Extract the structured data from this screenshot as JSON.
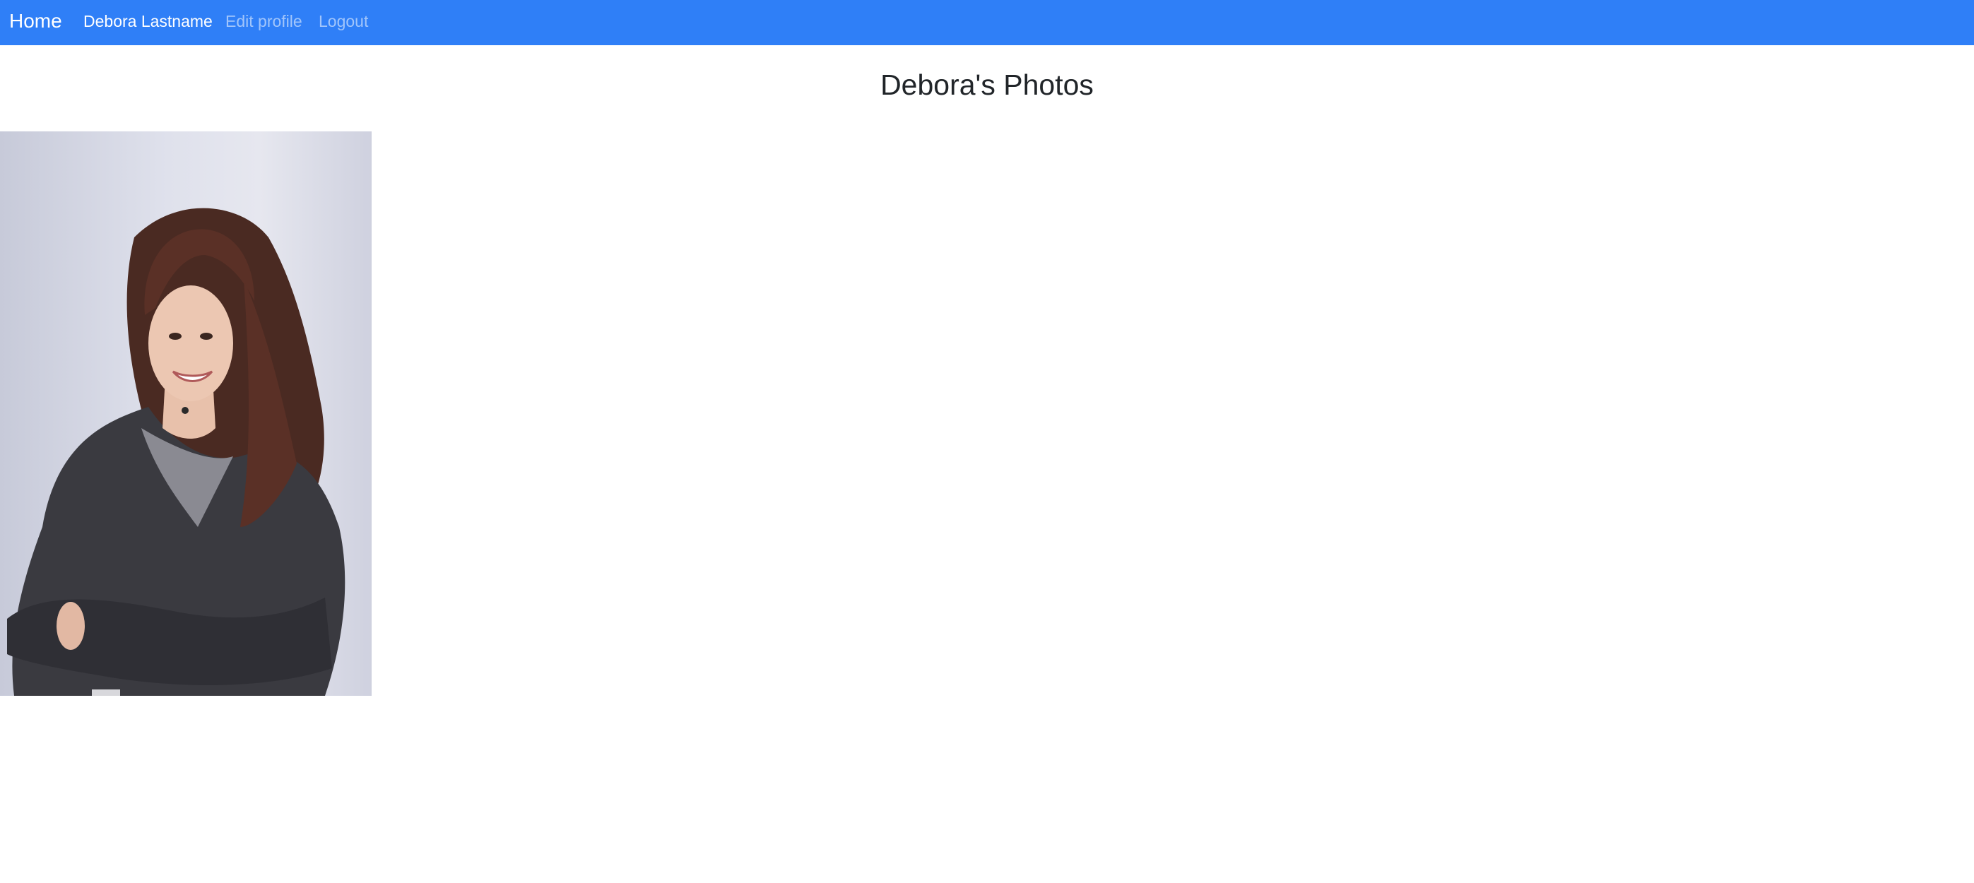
{
  "navbar": {
    "brand": "Home",
    "links": [
      {
        "label": "Debora Lastname",
        "active": true
      },
      {
        "label": "Edit profile",
        "active": false
      },
      {
        "label": "Logout",
        "active": false
      }
    ],
    "color": "#2f7ff7"
  },
  "page": {
    "title": "Debora's Photos"
  },
  "photos": [
    {
      "subject": "portrait of a smiling woman with long brown hair in a dark knit cardigan, arms crossed"
    }
  ]
}
